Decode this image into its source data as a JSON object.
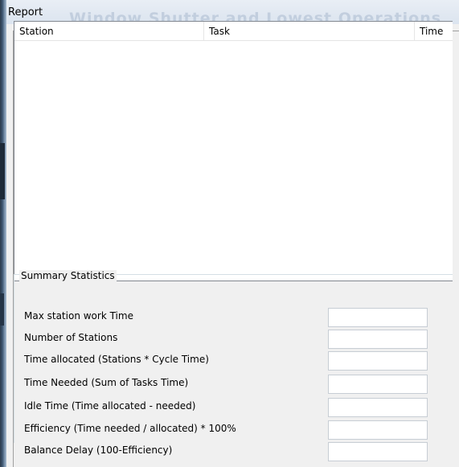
{
  "window": {
    "title": "Report",
    "background_title": "Window Shutter and Lowest Operations"
  },
  "report_list": {
    "columns": [
      "Station",
      "Task",
      "Time"
    ],
    "rows": []
  },
  "summary": {
    "caption": "Summary Statistics",
    "stats": [
      {
        "label": "Max station work Time",
        "value": ""
      },
      {
        "label": "Number of Stations",
        "value": ""
      },
      {
        "label": "Time allocated (Stations * Cycle Time)",
        "value": ""
      },
      {
        "label": "Time Needed (Sum of Tasks Time)",
        "value": ""
      },
      {
        "label": "Idle Time (Time allocated - needed)",
        "value": ""
      },
      {
        "label": "Efficiency (Time needed / allocated) * 100%",
        "value": ""
      },
      {
        "label": "Balance Delay (100-Efficiency)",
        "value": ""
      }
    ]
  }
}
